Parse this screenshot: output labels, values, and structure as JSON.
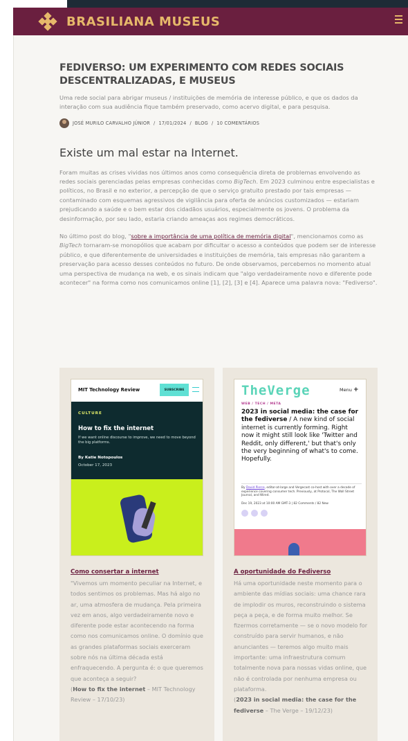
{
  "site": {
    "brand": "BRASILIANA MUSEUS",
    "colors": {
      "header_bg": "#6a1f3f",
      "brand_text": "#e6b86a",
      "link": "#6a1f3f"
    }
  },
  "article": {
    "title": "FEDIVERSO: UM EXPERIMENTO COM REDES SOCIAIS DESCENTRALIZADAS, E MUSEUS",
    "intro": "Uma rede social para abrigar museus / instituições de memória de interesse público, e que os dados da interação com sua audiência fique também preservado, como acervo digital, e para pesquisa.",
    "meta": {
      "author": "JOSÉ MURILO CARVALHO JÚNIOR",
      "date": "17/01/2024",
      "category": "BLOG",
      "comments": "10 COMENTÁRIOS",
      "separator": "/"
    },
    "section_heading": "Existe um mal estar na Internet.",
    "para1": {
      "before": "Foram muitas as crises vividas nos últimos anos como consequência direta de problemas envolvendo as redes sociais gerenciadas pelas empresas conhecidas como ",
      "italic": "BigTech",
      "after": ". Em 2023 culminou entre especialistas e políticos, no Brasil e no exterior, a percepção de que o serviço gratuito prestado por tais empresas — contaminado com esquemas agressivos de vigilância para oferta de anúncios customizados — estariam prejudicando a saúde e o bem estar dos cidadãos usuários, especialmente os jovens. O problema da desinformação, por seu lado, estaria criando ameaças aos regimes democráticos."
    },
    "para2": {
      "before": "No último post do blog, \"",
      "link": "sobre a importância de uma política de memória digital",
      "mid1": "\", mencionamos como as ",
      "italic": "BigTech",
      "after": " tornaram-se monopólios que acabam por dificultar o acesso a conteúdos que podem ser de interesse público, e que diferentemente de universidades e instituições de memória, tais empresas não garantem a preservação para acesso desses conteúdos no futuro. De onde observamos, percebemos no momento atual uma perspectiva de mudança na web, e os sinais indicam que \"algo verdadeiramente novo e diferente pode acontecer\" na forma como nos comunicamos online [1], [2], [3] e [4]. Aparece uma palavra nova: \"Fediverso\"."
    }
  },
  "cards": [
    {
      "link_title": "Como consertar a internet",
      "body": "\"Vivemos um momento peculiar na Internet, e todos sentimos os problemas. Mas há algo no ar, uma atmosfera de mudança. Pela primeira vez em anos, algo verdadeiramente novo e diferente pode estar acontecendo na forma como nos comunicamos online. O domínio que as grandes plataformas sociais exerceram sobre nós na última década está enfraquecendo. A pergunta é: o que queremos que aconteça a seguir?",
      "source_bold": "How to fix the internet",
      "source_rest": " – MIT Technology Review – 17/10/23)",
      "thumb": {
        "site": "MIT Technology Review",
        "subscribe": "SUBSCRIBE",
        "kicker": "CULTURE",
        "headline": "How to fix the internet",
        "dek": "If we want online discourse to improve, we need to move beyond the big platforms.",
        "byline": "By Katie Notopoulos",
        "date": "October 17, 2023"
      }
    },
    {
      "link_title": "A oportunidade do Fediverso",
      "body": "Há uma oportunidade neste momento para o ambiente das mídias sociais: uma chance rara de implodir os muros, reconstruindo o sistema peça a peça, e de forma muito melhor. Se fizermos corretamente — se o novo modelo for construído para servir humanos, e não anunciantes — teremos algo muito mais importante: uma infraestrutura comum totalmente nova para nossas vidas online, que não é controlada por nenhuma empresa ou plataforma.",
      "source_bold": "2023 in social media: the case for the fediverse",
      "source_rest": " – The Verge – 19/12/23)",
      "thumb": {
        "site": "TheVerge",
        "menu": "Menu",
        "crumb": "WEB / TECH / META",
        "headline_bold": "2023 in social media: the case for the fediverse",
        "headline_rest": " / A new kind of social internet is currently forming. Right now it might still look like 'Twitter and Reddit, only different,' but that's only the very beginning of what's to come. Hopefully.",
        "byline_name": "David Pierce",
        "byline_rest": ", editor-at-large and Vergecast co-host with over a decade of experience covering consumer tech. Previously, at Protocol, The Wall Street Journal, and Wired.",
        "dateline": "Dec 19, 2023 at 10:00 AM GMT-3",
        "comments": "82 Comments / 82 New"
      }
    }
  ]
}
